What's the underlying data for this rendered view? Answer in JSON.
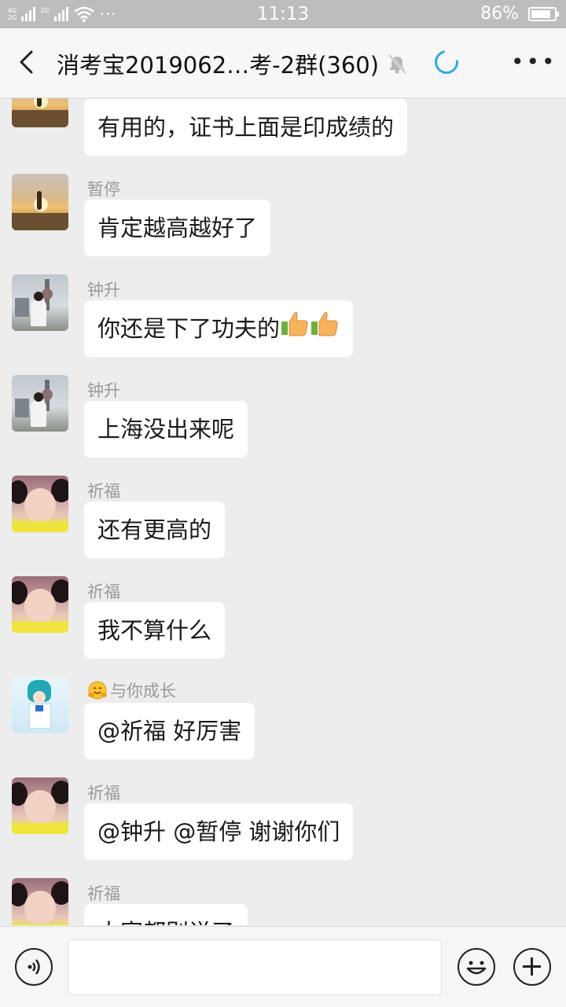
{
  "status_bar": {
    "network_top": "4G",
    "network_bottom": "2G",
    "network2": "2G",
    "more_dots": "···",
    "time": "11:13",
    "battery_percent": "86%",
    "battery_level": 0.86
  },
  "header": {
    "title": "消考宝2019062…考-2群(360)",
    "icons": [
      "back-arrow-icon",
      "mute-bell-icon",
      "loading-spinner-icon",
      "more-icon"
    ]
  },
  "messages": [
    {
      "sender": "",
      "text": "有用的，证书上面是印成绩的",
      "avatar": "sunset"
    },
    {
      "sender": "暂停",
      "text": "肯定越高越好了",
      "avatar": "sunset"
    },
    {
      "sender": "钟升",
      "text": "你还是下了功夫的",
      "emoji_after": "thumbs-up-icon x2",
      "avatar": "city"
    },
    {
      "sender": "钟升",
      "text": "上海没出来呢",
      "avatar": "city"
    },
    {
      "sender": "祈福",
      "text": "还有更高的",
      "avatar": "girl"
    },
    {
      "sender": "祈福",
      "text": "我不算什么",
      "avatar": "girl"
    },
    {
      "sender": "与你成长",
      "sender_emoji": "hug-emoji-icon",
      "text": "@祈福 好厉害",
      "avatar": "anime"
    },
    {
      "sender": "祈福",
      "text": "@钟升 @暂停  谢谢你们",
      "avatar": "girl"
    },
    {
      "sender": "祈福",
      "text": "大家都别说了",
      "avatar": "girl"
    }
  ],
  "input_bar": {
    "placeholder": "",
    "icons": [
      "voice-icon",
      "emoji-icon",
      "plus-icon"
    ]
  },
  "colors": {
    "chat_background": "#ededed",
    "bubble": "#ffffff",
    "accent_spinner": "#29a9e8",
    "status_bar": "#bdbdbd"
  }
}
